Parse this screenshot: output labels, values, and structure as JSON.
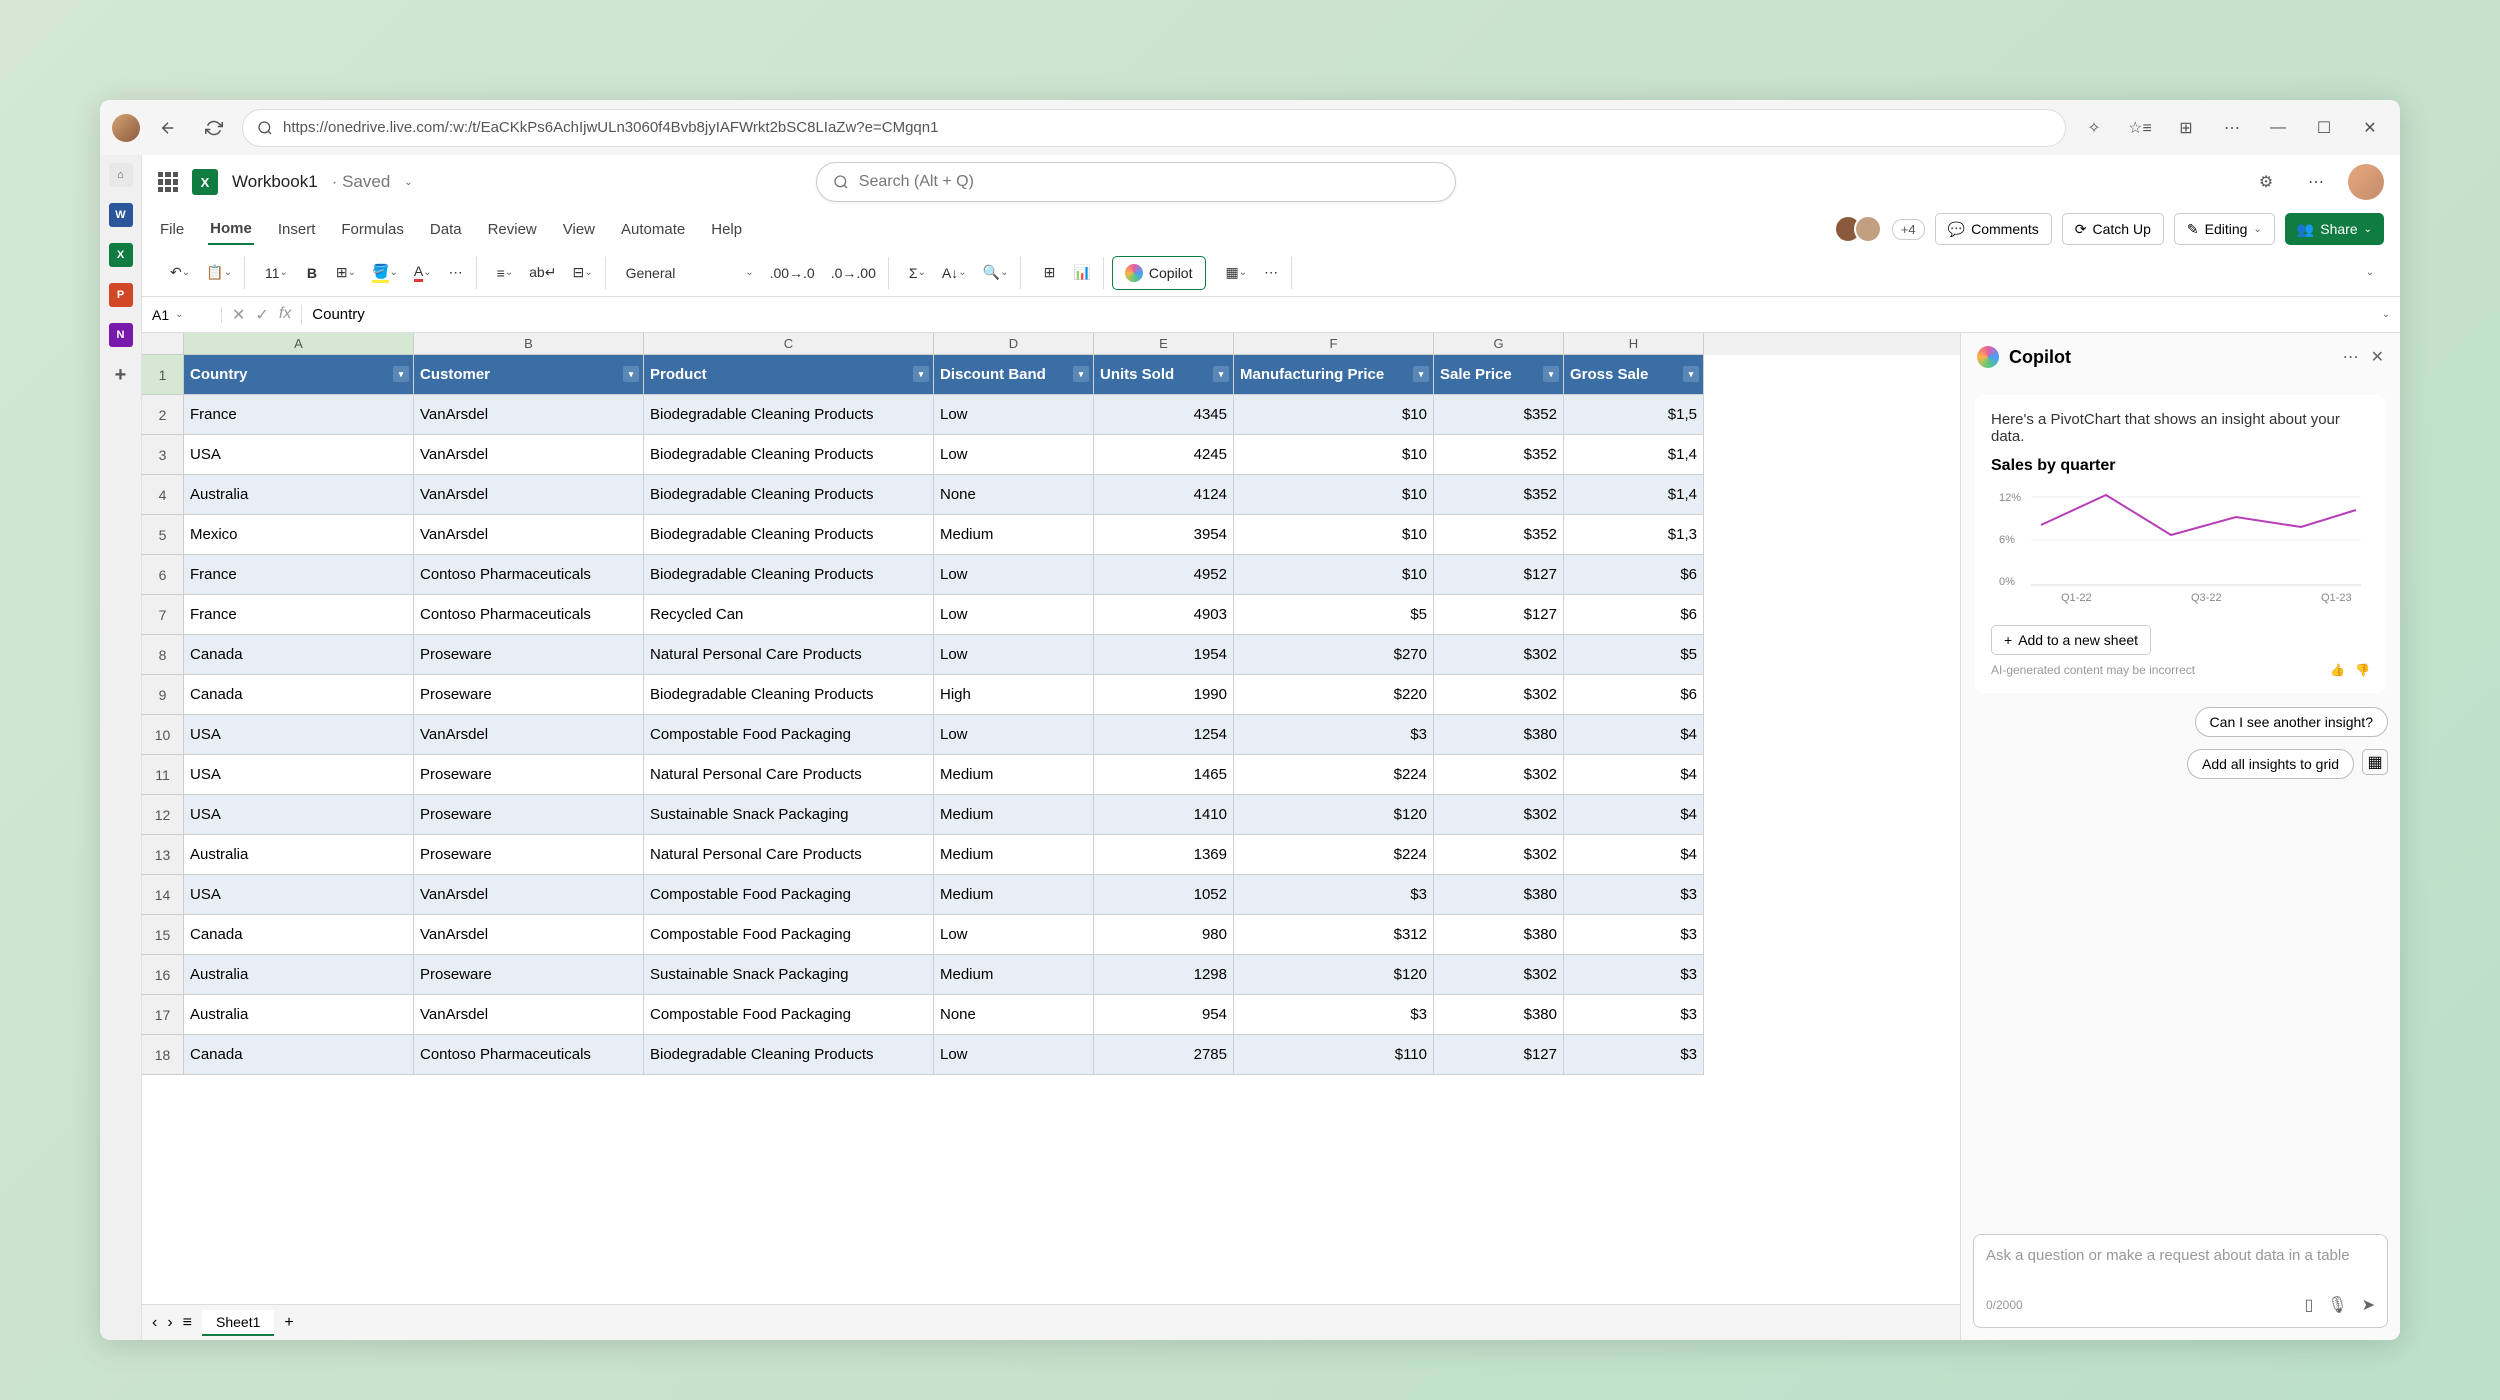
{
  "browser": {
    "url": "https://onedrive.live.com/:w:/t/EaCKkPs6AchIjwULn3060f4Bvb8jyIAFWrkt2bSC8LIaZw?e=CMgqn1"
  },
  "header": {
    "doc_title": "Workbook1",
    "saved_label": "· Saved",
    "search_placeholder": "Search (Alt + Q)"
  },
  "tabs": {
    "items": [
      "File",
      "Home",
      "Insert",
      "Formulas",
      "Data",
      "Review",
      "View",
      "Automate",
      "Help"
    ],
    "active": "Home",
    "presence_extra": "+4",
    "comments": "Comments",
    "catchup": "Catch Up",
    "editing": "Editing",
    "share": "Share"
  },
  "ribbon": {
    "font_size": "11",
    "number_format": "General",
    "copilot": "Copilot"
  },
  "formula_bar": {
    "cell_ref": "A1",
    "formula": "Country"
  },
  "columns": [
    "A",
    "B",
    "C",
    "D",
    "E",
    "F",
    "G",
    "H"
  ],
  "table": {
    "headers": [
      "Country",
      "Customer",
      "Product",
      "Discount Band",
      "Units Sold",
      "Manufacturing Price",
      "Sale Price",
      "Gross Sale"
    ],
    "rows": [
      {
        "n": 2,
        "c": [
          "France",
          "VanArsdel",
          "Biodegradable Cleaning Products",
          "Low",
          "4345",
          "$10",
          "$352",
          "$1,5"
        ]
      },
      {
        "n": 3,
        "c": [
          "USA",
          "VanArsdel",
          "Biodegradable Cleaning Products",
          "Low",
          "4245",
          "$10",
          "$352",
          "$1,4"
        ]
      },
      {
        "n": 4,
        "c": [
          "Australia",
          "VanArsdel",
          "Biodegradable Cleaning Products",
          "None",
          "4124",
          "$10",
          "$352",
          "$1,4"
        ]
      },
      {
        "n": 5,
        "c": [
          "Mexico",
          "VanArsdel",
          "Biodegradable Cleaning Products",
          "Medium",
          "3954",
          "$10",
          "$352",
          "$1,3"
        ]
      },
      {
        "n": 6,
        "c": [
          "France",
          "Contoso Pharmaceuticals",
          "Biodegradable Cleaning Products",
          "Low",
          "4952",
          "$10",
          "$127",
          "$6"
        ]
      },
      {
        "n": 7,
        "c": [
          "France",
          "Contoso Pharmaceuticals",
          "Recycled Can",
          "Low",
          "4903",
          "$5",
          "$127",
          "$6"
        ]
      },
      {
        "n": 8,
        "c": [
          "Canada",
          "Proseware",
          "Natural Personal Care Products",
          "Low",
          "1954",
          "$270",
          "$302",
          "$5"
        ]
      },
      {
        "n": 9,
        "c": [
          "Canada",
          "Proseware",
          "Biodegradable Cleaning Products",
          "High",
          "1990",
          "$220",
          "$302",
          "$6"
        ]
      },
      {
        "n": 10,
        "c": [
          "USA",
          "VanArsdel",
          "Compostable Food Packaging",
          "Low",
          "1254",
          "$3",
          "$380",
          "$4"
        ]
      },
      {
        "n": 11,
        "c": [
          "USA",
          "Proseware",
          "Natural Personal Care Products",
          "Medium",
          "1465",
          "$224",
          "$302",
          "$4"
        ]
      },
      {
        "n": 12,
        "c": [
          "USA",
          "Proseware",
          "Sustainable Snack Packaging",
          "Medium",
          "1410",
          "$120",
          "$302",
          "$4"
        ]
      },
      {
        "n": 13,
        "c": [
          "Australia",
          "Proseware",
          "Natural Personal Care Products",
          "Medium",
          "1369",
          "$224",
          "$302",
          "$4"
        ]
      },
      {
        "n": 14,
        "c": [
          "USA",
          "VanArsdel",
          "Compostable Food Packaging",
          "Medium",
          "1052",
          "$3",
          "$380",
          "$3"
        ]
      },
      {
        "n": 15,
        "c": [
          "Canada",
          "VanArsdel",
          "Compostable Food Packaging",
          "Low",
          "980",
          "$312",
          "$380",
          "$3"
        ]
      },
      {
        "n": 16,
        "c": [
          "Australia",
          "Proseware",
          "Sustainable Snack Packaging",
          "Medium",
          "1298",
          "$120",
          "$302",
          "$3"
        ]
      },
      {
        "n": 17,
        "c": [
          "Australia",
          "VanArsdel",
          "Compostable Food Packaging",
          "None",
          "954",
          "$3",
          "$380",
          "$3"
        ]
      },
      {
        "n": 18,
        "c": [
          "Canada",
          "Contoso Pharmaceuticals",
          "Biodegradable Cleaning Products",
          "Low",
          "2785",
          "$110",
          "$127",
          "$3"
        ]
      }
    ]
  },
  "sheet_tabs": {
    "active": "Sheet1"
  },
  "copilot": {
    "title": "Copilot",
    "message": "Here's a PivotChart that shows an insight about your data.",
    "chart_title": "Sales by quarter",
    "add_btn": "Add to a new sheet",
    "disclaimer": "AI-generated content may be incorrect",
    "suggestions": [
      "Can I see another insight?",
      "Add all insights to grid"
    ],
    "input_placeholder": "Ask a question or make a request about data in a table",
    "char_count": "0/2000"
  },
  "chart_data": {
    "type": "line",
    "title": "Sales by quarter",
    "categories": [
      "Q1-22",
      "Q3-22",
      "Q1-23"
    ],
    "y_ticks": [
      "12%",
      "6%",
      "0%"
    ],
    "values_pct": [
      9,
      13,
      8,
      10,
      9,
      11
    ],
    "ylim": [
      0,
      14
    ],
    "color": "#b83db8"
  }
}
